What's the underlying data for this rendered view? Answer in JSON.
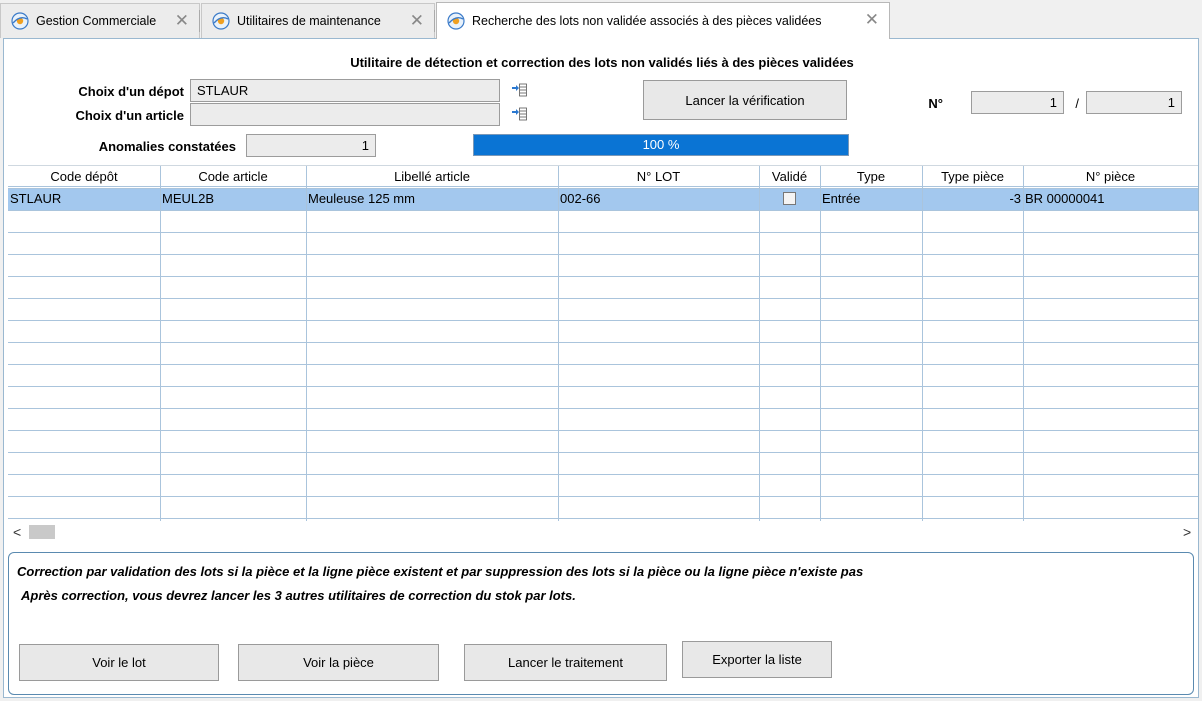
{
  "tabs": [
    {
      "label": "Gestion Commerciale",
      "active": false
    },
    {
      "label": "Utilitaires de maintenance",
      "active": false
    },
    {
      "label": "Recherche des lots non validée associés à des pièces validées",
      "active": true
    }
  ],
  "header": {
    "title": "Utilitaire de détection et correction des lots non validés liés à des pièces validées"
  },
  "form": {
    "depot_label": "Choix d'un dépot",
    "depot_value": "STLAUR",
    "article_label": "Choix d'un article",
    "article_value": "",
    "anomalies_label": "Anomalies constatées",
    "anomalies_value": "1",
    "launch_button": "Lancer la vérification",
    "counter_label": "N°",
    "counter_current": "1",
    "counter_sep": "/",
    "counter_total": "1",
    "progress_text": "100 %",
    "progress_value": 100
  },
  "table": {
    "columns": [
      "Code dépôt",
      "Code article",
      "Libellé article",
      "N° LOT",
      "Validé",
      "Type",
      "Type pièce",
      "N° pièce"
    ],
    "rows": [
      {
        "code_depot": "STLAUR",
        "code_article": "MEUL2B",
        "libelle": "Meuleuse 125 mm",
        "lot": "002-66",
        "valide": false,
        "type": "Entrée",
        "type_piece": "-3",
        "piece": "BR 00000041",
        "selected": true
      }
    ],
    "empty_rows": 14
  },
  "footer": {
    "note_line1": "Correction par validation des lots si la pièce et la ligne pièce existent et par suppression des lots si la pièce ou la ligne pièce n'existe pas",
    "note_line2": "Après correction, vous devrez lancer les 3 autres utilitaires de correction du stok par lots.",
    "btn_voir_lot": "Voir le lot",
    "btn_voir_piece": "Voir la pièce",
    "btn_lancer": "Lancer le traitement",
    "btn_exporter": "Exporter la liste"
  },
  "colors": {
    "accent": "#0a74d4",
    "selection": "#a3c8ee",
    "border": "#9ab8d0"
  }
}
